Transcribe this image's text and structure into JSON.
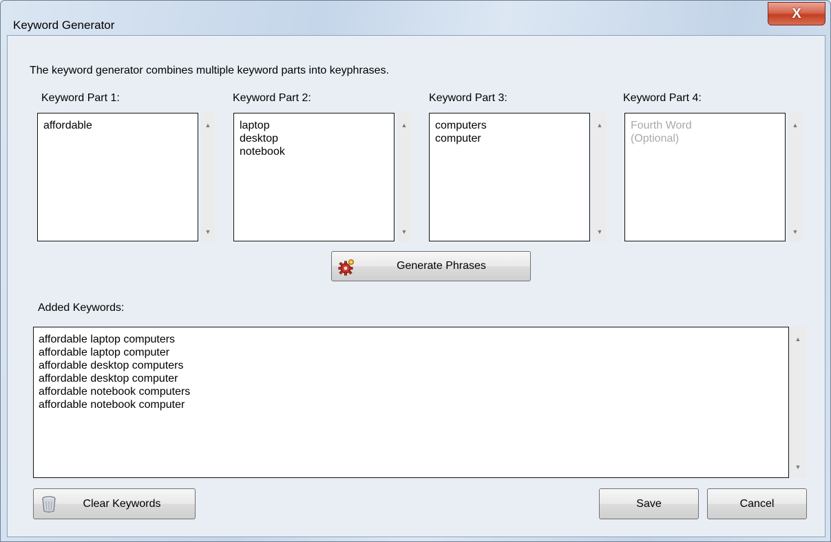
{
  "window": {
    "title": "Keyword Generator",
    "close_label": "X"
  },
  "intro": "The keyword generator combines multiple keyword parts into keyphrases.",
  "parts": [
    {
      "label": "Keyword Part 1:",
      "items": [
        "affordable"
      ],
      "placeholder": []
    },
    {
      "label": "Keyword Part 2:",
      "items": [
        "laptop",
        "desktop",
        "notebook"
      ],
      "placeholder": []
    },
    {
      "label": "Keyword Part 3:",
      "items": [
        "computers",
        "computer"
      ],
      "placeholder": []
    },
    {
      "label": "Keyword Part 4:",
      "items": [],
      "placeholder": [
        "Fourth Word",
        "(Optional)"
      ]
    }
  ],
  "scroll_arrows": {
    "up": "▲",
    "down": "▼"
  },
  "generate_button": {
    "label": "Generate Phrases",
    "icon": "gear-icon"
  },
  "added": {
    "label": "Added Keywords:",
    "items": [
      "affordable laptop computers",
      "affordable laptop computer",
      "affordable desktop computers",
      "affordable desktop computer",
      "affordable notebook computers",
      "affordable notebook computer"
    ]
  },
  "buttons": {
    "clear": {
      "label": "Clear Keywords",
      "icon": "trash-can-icon"
    },
    "save": "Save",
    "cancel": "Cancel"
  }
}
